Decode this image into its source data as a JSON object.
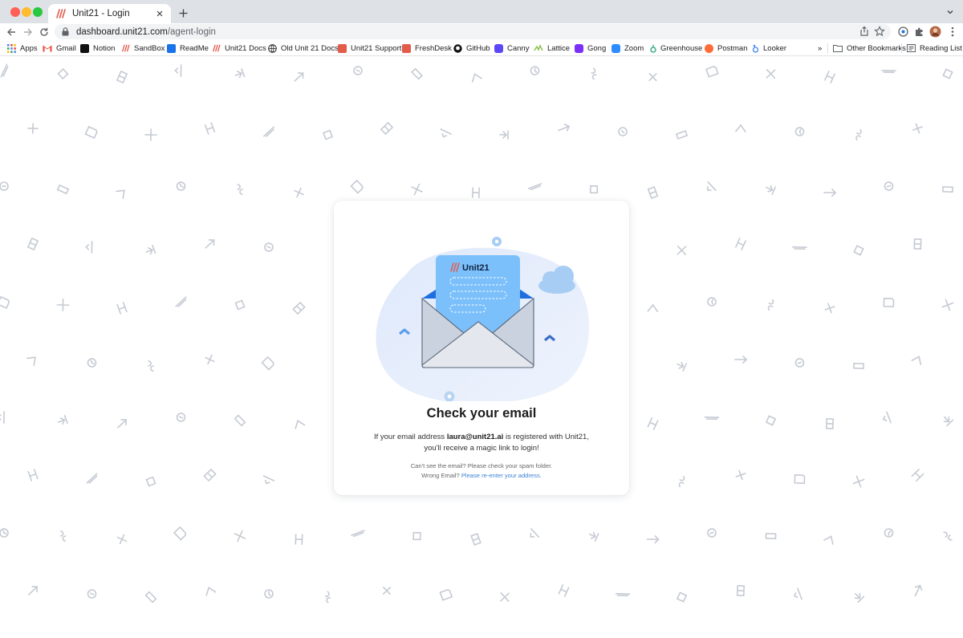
{
  "browser": {
    "tab_title": "Unit21 - Login",
    "url_host": "dashboard.unit21.com",
    "url_path": "/agent-login",
    "bookmarks": [
      {
        "label": "Apps",
        "icon": "apps-grid-icon",
        "color": "#e8453c"
      },
      {
        "label": "Gmail",
        "icon": "gmail-icon",
        "color": "#ea4335"
      },
      {
        "label": "Notion",
        "icon": "notion-icon",
        "color": "#111111"
      },
      {
        "label": "SandBox",
        "icon": "unit21-icon",
        "color": "#e25b4b"
      },
      {
        "label": "ReadMe",
        "icon": "readme-icon",
        "color": "#1a73e8"
      },
      {
        "label": "Unit21 Docs",
        "icon": "unit21-icon",
        "color": "#e25b4b"
      },
      {
        "label": "Old Unit 21 Docs",
        "icon": "globe-icon",
        "color": "#202124"
      },
      {
        "label": "Unit21 Support",
        "icon": "support-icon",
        "color": "#e25b4b"
      },
      {
        "label": "FreshDesk",
        "icon": "freshdesk-icon",
        "color": "#e25b4b"
      },
      {
        "label": "GitHub",
        "icon": "github-icon",
        "color": "#111111"
      },
      {
        "label": "Canny",
        "icon": "canny-icon",
        "color": "#5b47f5"
      },
      {
        "label": "Lattice",
        "icon": "lattice-icon",
        "color": "#8bc34a"
      },
      {
        "label": "Gong",
        "icon": "gong-icon",
        "color": "#7b2ff7"
      },
      {
        "label": "Zoom",
        "icon": "zoom-icon",
        "color": "#2d8cff"
      },
      {
        "label": "Greenhouse",
        "icon": "greenhouse-icon",
        "color": "#24a47f"
      },
      {
        "label": "Postman",
        "icon": "postman-icon",
        "color": "#ff6c37"
      },
      {
        "label": "Looker",
        "icon": "looker-icon",
        "color": "#4285f4"
      }
    ],
    "overflow_label": "»",
    "other_bookmarks": "Other Bookmarks",
    "reading_list": "Reading List"
  },
  "card": {
    "logo_text": "Unit21",
    "heading": "Check your email",
    "message_prefix": "If your email address ",
    "email": "laura@unit21.ai",
    "message_suffix": " is registered with Unit21, you'll receive a magic link to login!",
    "spam_hint": "Can't see the email? Please check your spam folder.",
    "wrong_email_prefix": "Wrong Email? ",
    "reenter_link": "Please re-enter your address."
  },
  "colors": {
    "accent": "#3b82d6",
    "card_blob": "#e3ecfb",
    "letter": "#7cc0fb"
  }
}
